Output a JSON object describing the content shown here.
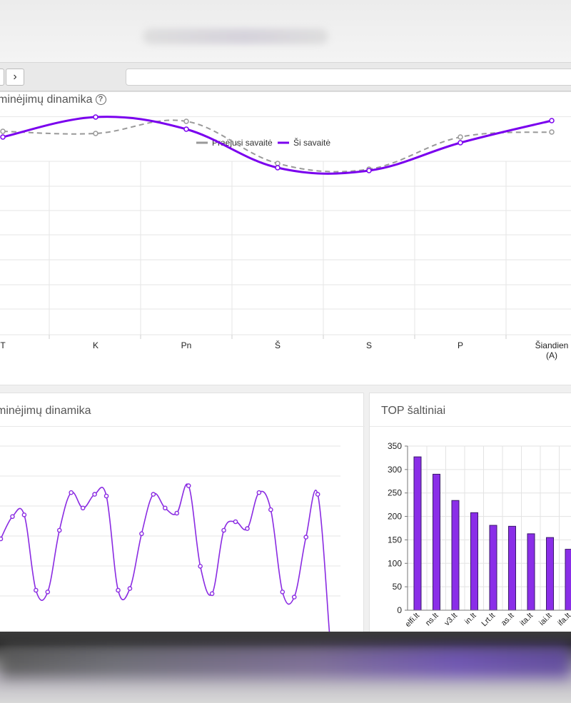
{
  "browser": {
    "back_symbol": "",
    "forward_symbol": "›"
  },
  "colors": {
    "purple": "#7a00ee",
    "gray": "#999999",
    "bar_fill": "#8a2ee8",
    "bar_stroke": "#3a1a6a"
  },
  "top_panel": {
    "title": "minėjimų dinamika",
    "help_icon": "?",
    "legend": [
      {
        "name": "Praėjusi savaitė",
        "color": "#999999",
        "dashed": true
      },
      {
        "name": "Ši savaitė",
        "color": "#7a00ee",
        "dashed": false
      }
    ]
  },
  "bottom_left_panel": {
    "title": "minėjimų dinamika"
  },
  "bottom_right_panel": {
    "title": "TOP šaltiniai"
  },
  "chart_data": [
    {
      "type": "line",
      "categories": [
        "T",
        "K",
        "Pn",
        "Š",
        "S",
        "P",
        "Šiandien\n(A)"
      ],
      "series": [
        {
          "name": "Praėjusi savaitė",
          "values": [
            65,
            62,
            79,
            20,
            12,
            57,
            64
          ],
          "style": "dashed"
        },
        {
          "name": "Ši savaitė",
          "values": [
            57,
            85,
            68,
            14,
            10,
            49,
            80
          ],
          "style": "solid"
        }
      ],
      "grid": true,
      "legend": "top-center"
    },
    {
      "type": "line",
      "values": [
        55,
        68,
        69,
        25,
        24,
        60,
        82,
        73,
        81,
        80,
        25,
        26,
        58,
        81,
        73,
        70,
        86,
        39,
        23,
        60,
        65,
        61,
        82,
        72,
        24,
        21,
        56,
        81,
        0
      ],
      "grid": true
    },
    {
      "type": "bar",
      "categories": [
        "elfi.lt",
        "ns.lt",
        "v3.lt",
        "in.lt",
        "Lrt.lt",
        "as.lt",
        "ita.lt",
        "iai.lt",
        "ifa.lt"
      ],
      "values": [
        327,
        290,
        234,
        208,
        181,
        179,
        163,
        155,
        130
      ],
      "yticks": [
        "0",
        "50",
        "100",
        "150",
        "200",
        "250",
        "300",
        "350"
      ],
      "ylim": [
        0,
        350
      ],
      "grid": true
    }
  ]
}
